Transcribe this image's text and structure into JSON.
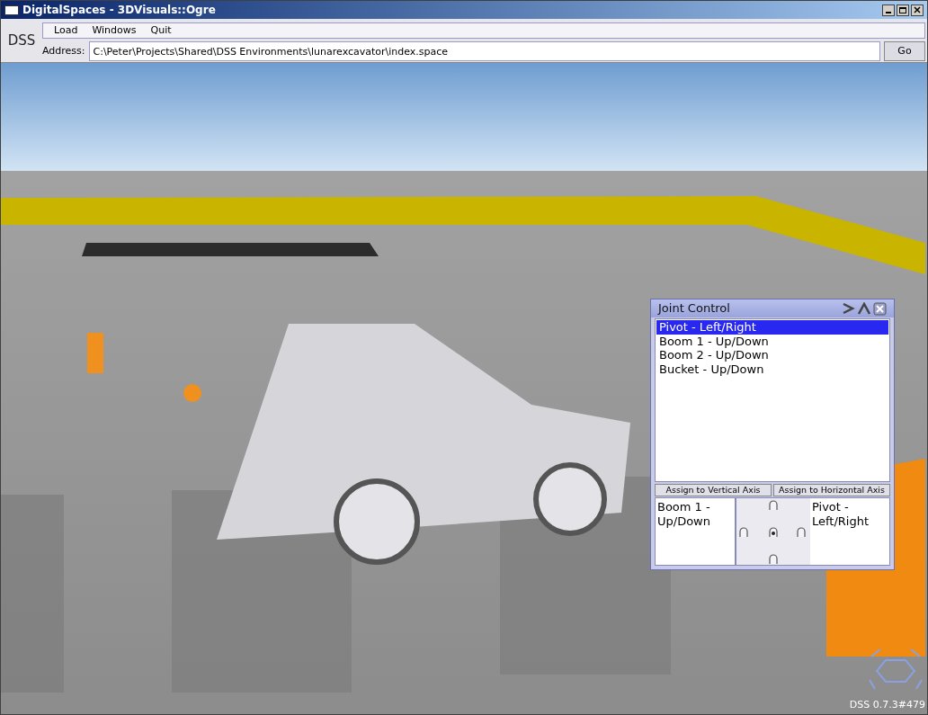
{
  "window": {
    "title": "DigitalSpaces - 3DVisuals::Ogre"
  },
  "app_label": "DSS",
  "menu": [
    "Load",
    "Windows",
    "Quit"
  ],
  "address": {
    "label": "Address:",
    "value": "C:\\Peter\\Projects\\Shared\\DSS Environments\\lunarexcavator\\index.space",
    "button": "Go"
  },
  "joint_control": {
    "title": "Joint Control",
    "items": [
      {
        "label": "Pivot - Left/Right",
        "selected": true
      },
      {
        "label": "Boom 1 - Up/Down",
        "selected": false
      },
      {
        "label": "Boom 2 - Up/Down",
        "selected": false
      },
      {
        "label": "Bucket - Up/Down",
        "selected": false
      }
    ],
    "axis_buttons": [
      "Assign to Vertical Axis",
      "Assign to Horizontal Axis"
    ],
    "vertical_axis": "Boom 1 - Up/Down",
    "horizontal_axis": "Pivot - Left/Right"
  },
  "version": "DSS 0.7.3#479"
}
